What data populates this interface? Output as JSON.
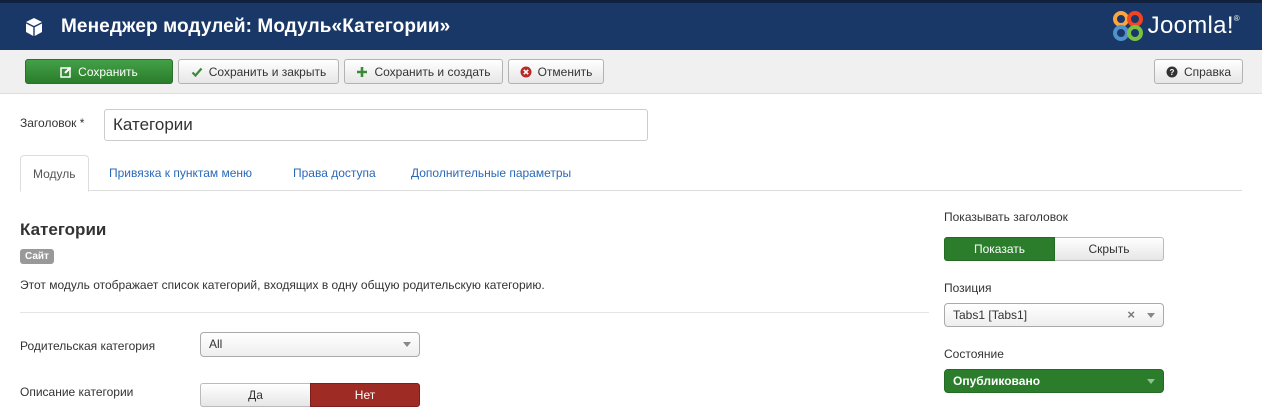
{
  "header": {
    "title": "Менеджер модулей: Модуль«Категории»",
    "logo_text": "Joomla!",
    "logo_reg": "®"
  },
  "toolbar": {
    "save_label": "Сохранить",
    "save_close_label": "Сохранить и закрыть",
    "save_new_label": "Сохранить и создать",
    "cancel_label": "Отменить",
    "help_label": "Справка"
  },
  "form": {
    "title_label": "Заголовок *",
    "title_value": "Категории"
  },
  "tabs": [
    {
      "label": "Модуль",
      "active": true
    },
    {
      "label": "Привязка к пунктам меню",
      "active": false
    },
    {
      "label": "Права доступа",
      "active": false
    },
    {
      "label": "Дополнительные параметры",
      "active": false
    }
  ],
  "module": {
    "heading": "Категории",
    "badge": "Сайт",
    "description": "Этот модуль отображает список категорий, входящих в одну общую родительскую категорию."
  },
  "fields": {
    "parent_label": "Родительская категория",
    "parent_value": "All",
    "catdesc_label": "Описание категории",
    "catdesc_yes": "Да",
    "catdesc_no": "Нет",
    "catdesc_selected": "Нет"
  },
  "sidebar": {
    "show_title_label": "Показывать заголовок",
    "show_label": "Показать",
    "hide_label": "Скрыть",
    "show_selected": "Показать",
    "position_label": "Позиция",
    "position_value": "Tabs1 [Tabs1]",
    "clear_glyph": "×",
    "state_label": "Состояние",
    "state_value": "Опубликовано"
  },
  "colors": {
    "header_bg": "#1a3867",
    "save_green": "#2b7d2c",
    "no_red": "#9e2b24",
    "link_blue": "#2a69b8"
  },
  "icons": [
    "cube-icon",
    "joomla-logo-icon",
    "edit-icon",
    "check-icon",
    "plus-icon",
    "cancel-circle-icon",
    "help-icon"
  ]
}
